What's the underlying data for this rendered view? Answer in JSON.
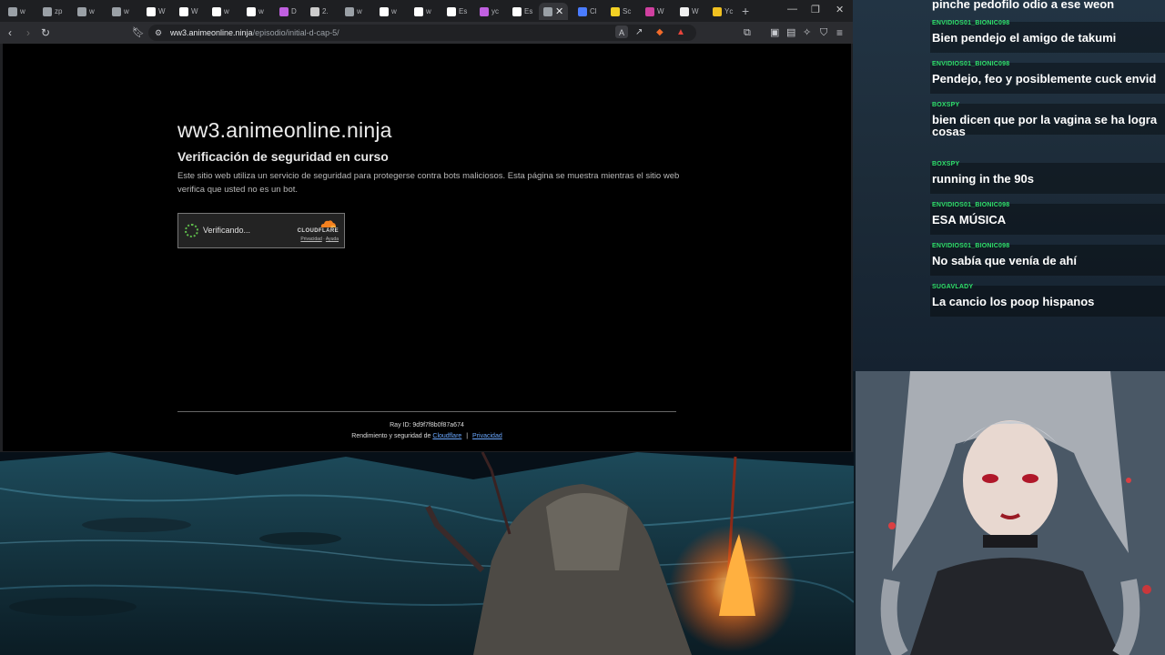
{
  "browser": {
    "tabs": [
      {
        "label": "w",
        "color": "#9aa0a6",
        "icon": "globe-icon"
      },
      {
        "label": "zp",
        "color": "#9aa0a6",
        "icon": "globe-icon"
      },
      {
        "label": "w",
        "color": "#9aa0a6",
        "icon": "loading-icon"
      },
      {
        "label": "w",
        "color": "#9aa0a6",
        "icon": "globe-icon"
      },
      {
        "label": "W",
        "color": "#ffffff",
        "icon": "p-icon"
      },
      {
        "label": "W",
        "color": "#ffffff",
        "icon": "p-icon"
      },
      {
        "label": "w",
        "color": "#ffffff",
        "icon": "a-icon"
      },
      {
        "label": "w",
        "color": "#ffffff",
        "icon": "a-icon"
      },
      {
        "label": "D",
        "color": "#c060e0",
        "icon": "music-icon"
      },
      {
        "label": "2.",
        "color": "#cccccc",
        "icon": "page-icon"
      },
      {
        "label": "w",
        "color": "#9aa0a6",
        "icon": "globe-icon"
      },
      {
        "label": "w",
        "color": "#ffffff",
        "icon": "a-icon"
      },
      {
        "label": "w",
        "color": "#ffffff",
        "icon": "a-icon"
      },
      {
        "label": "Es",
        "color": "#ffffff",
        "icon": "p-icon"
      },
      {
        "label": "yc",
        "color": "#c060e0",
        "icon": "music-icon"
      },
      {
        "label": "Es",
        "color": "#ffffff",
        "icon": "p-icon"
      },
      {
        "label": "",
        "color": "#9aa0a6",
        "icon": "speaker-icon",
        "active": true
      },
      {
        "label": "Cl",
        "color": "#4a7cff",
        "icon": "c-icon"
      },
      {
        "label": "Sc",
        "color": "#f2d024",
        "icon": "doc-icon"
      },
      {
        "label": "W",
        "color": "#d040a0",
        "icon": "k-icon"
      },
      {
        "label": "W",
        "color": "#f0f0f0",
        "icon": "v-icon"
      },
      {
        "label": "Yc",
        "color": "#f0c020",
        "icon": "star-icon"
      }
    ],
    "url_host": "ww3.animeonline.ninja",
    "url_path": "/episodio/initial-d-cap-5/"
  },
  "page": {
    "site_title": "ww3.animeonline.ninja",
    "heading": "Verificación de seguridad en curso",
    "description": "Este sitio web utiliza un servicio de seguridad para protegerse contra bots maliciosos. Esta página se muestra mientras el sitio web verifica que usted no es un bot.",
    "widget": {
      "status": "Verificando...",
      "brand": "CLOUDFLARE",
      "link_privacy": "Privacidad",
      "link_help": "Ayuda"
    },
    "ray_id": "Ray ID: 9d9f7f8b0f87a674",
    "perf_prefix": "Rendimiento y seguridad de",
    "perf_link": "Cloudflare",
    "privacy_link": "Privacidad"
  },
  "chat": {
    "messages": [
      {
        "user": "",
        "text": "pinche pedofilo odio a ese weon"
      },
      {
        "user": "ENVIDIOS01_BIONIC098",
        "text": "Bien pendejo el amigo de takumi"
      },
      {
        "user": "ENVIDIOS01_BIONIC098",
        "text": "Pendejo, feo y posiblemente cuck envid"
      },
      {
        "user": "BOXSPY",
        "text": "bien dicen que por la vagina se ha logra"
      },
      {
        "user": "",
        "text": "cosas"
      },
      {
        "user": "BOXSPY",
        "text": "running in the 90s"
      },
      {
        "user": "ENVIDIOS01_BIONIC098",
        "text": "ESA MÚSICA"
      },
      {
        "user": "ENVIDIOS01_BIONIC098",
        "text": "No sabía que venía de ahí"
      },
      {
        "user": "SUGAVLADY",
        "text": "La cancio los poop hispanos"
      }
    ]
  }
}
